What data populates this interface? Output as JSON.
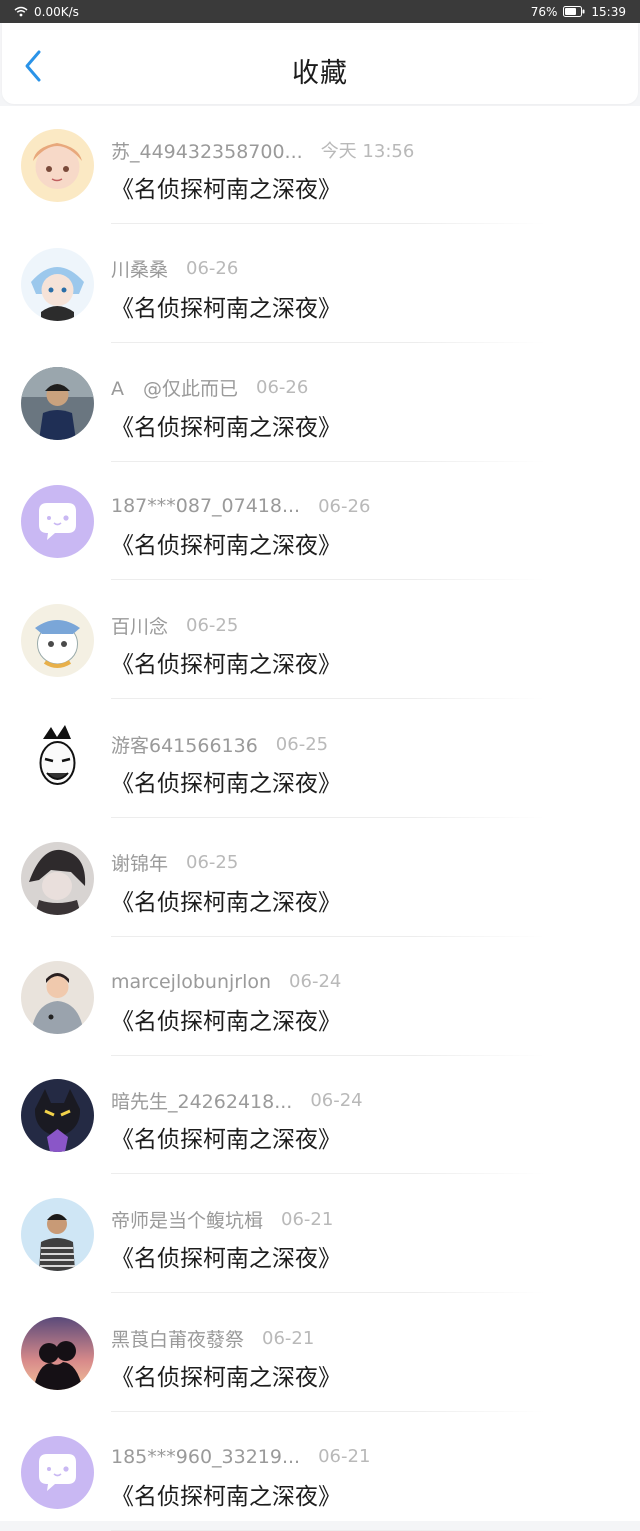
{
  "status_bar": {
    "network_speed": "0.00K/s",
    "battery": "76%",
    "time": "15:39"
  },
  "header": {
    "back_icon": "chevron-left-icon",
    "title": "收藏",
    "accent_color": "#2a93e8"
  },
  "items": [
    {
      "user": "苏_449432358700...",
      "time": "今天 13:56",
      "content": "《名侦探柯南之深夜》",
      "avatar": "anime-girl-avatar"
    },
    {
      "user": "川桑桑",
      "time": "06-26",
      "content": "《名侦探柯南之深夜》",
      "avatar": "anime-boy-avatar"
    },
    {
      "user": "A　@仅此而已",
      "time": "06-26",
      "content": "《名侦探柯南之深夜》",
      "avatar": "photo-man-avatar"
    },
    {
      "user": "187***087_07418...",
      "time": "06-26",
      "content": "《名侦探柯南之深夜》",
      "avatar": "default-chat-avatar"
    },
    {
      "user": "百川念",
      "time": "06-25",
      "content": "《名侦探柯南之深夜》",
      "avatar": "cartoon-cat-avatar"
    },
    {
      "user": "游客641566136",
      "time": "06-25",
      "content": "《名侦探柯南之深夜》",
      "avatar": "sketch-face-avatar"
    },
    {
      "user": "谢锦年",
      "time": "06-25",
      "content": "《名侦探柯南之深夜》",
      "avatar": "dark-anime-avatar"
    },
    {
      "user": "marcejlobunjrlon",
      "time": "06-24",
      "content": "《名侦探柯南之深夜》",
      "avatar": "child-photo-avatar"
    },
    {
      "user": "暗先生_24262418...",
      "time": "06-24",
      "content": "《名侦探柯南之深夜》",
      "avatar": "purple-character-avatar"
    },
    {
      "user": "帝师是当个鳆坑楫",
      "time": "06-21",
      "content": "《名侦探柯南之深夜》",
      "avatar": "boy-photo-avatar"
    },
    {
      "user": "黑莨白莆夜蕟祭",
      "time": "06-21",
      "content": "《名侦探柯南之深夜》",
      "avatar": "sunset-couple-avatar"
    },
    {
      "user": "185***960_33219...",
      "time": "06-21",
      "content": "《名侦探柯南之深夜》",
      "avatar": "default-chat-avatar"
    }
  ]
}
